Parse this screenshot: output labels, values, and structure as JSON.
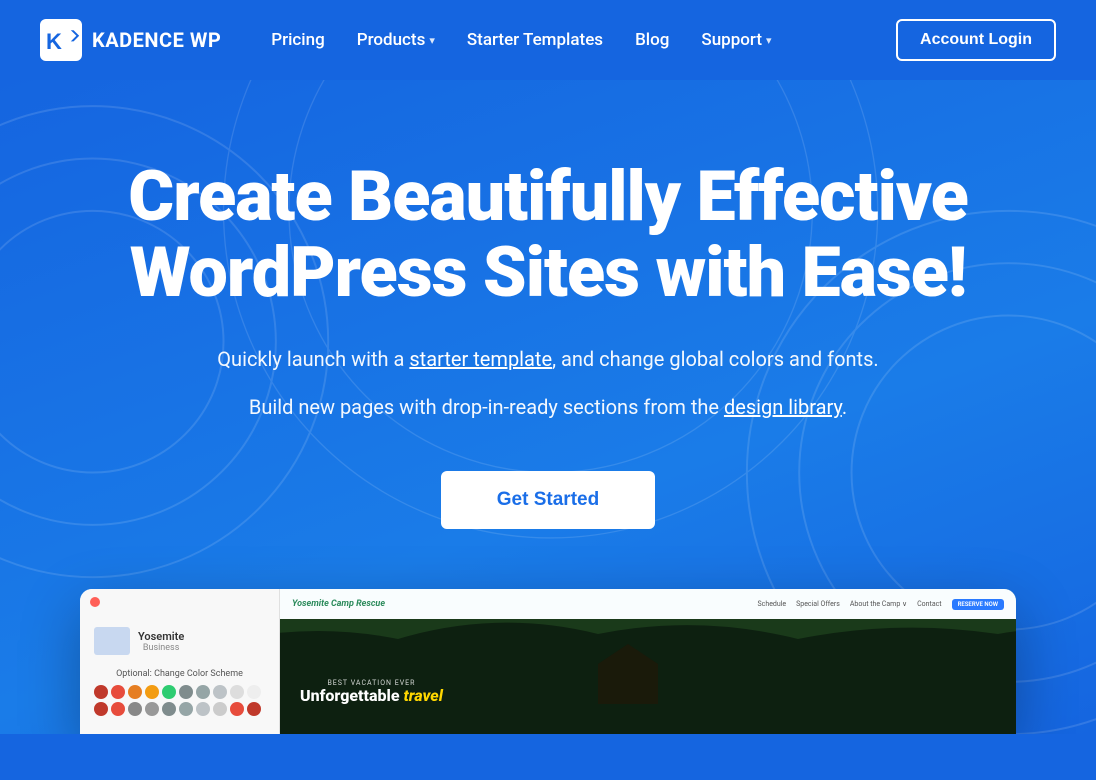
{
  "brand": {
    "name": "KADENCE WP",
    "logo_alt": "Kadence WP Logo"
  },
  "navbar": {
    "links": [
      {
        "label": "Pricing",
        "has_dropdown": false
      },
      {
        "label": "Products",
        "has_dropdown": true
      },
      {
        "label": "Starter Templates",
        "has_dropdown": false
      },
      {
        "label": "Blog",
        "has_dropdown": false
      },
      {
        "label": "Support",
        "has_dropdown": true
      }
    ],
    "account_login": "Account Login"
  },
  "hero": {
    "title": "Create Beautifully Effective WordPress Sites with Ease!",
    "subtitle_part1": "Quickly launch with a ",
    "subtitle_link1": "starter template",
    "subtitle_part2": ", and change global colors and fonts.",
    "subtitle2_part1": "Build new pages with drop-in-ready sections from the ",
    "subtitle2_link2": "design library",
    "subtitle2_part2": ".",
    "cta_button": "Get Started"
  },
  "preview": {
    "sidebar": {
      "site_name": "Yosemite",
      "site_type": "Business",
      "color_scheme_label": "Optional: Change Color Scheme",
      "swatches": [
        "#c0392b",
        "#e74c3c",
        "#e67e22",
        "#f39c12",
        "#27ae60",
        "#8e8e8e",
        "#7f8c8d",
        "#95a5a6",
        "#bdc3c7",
        "#ccc",
        "#ddd",
        "#eee",
        "#c0392b",
        "#e74c3c",
        "#888",
        "#999",
        "#7f8c8d",
        "#95a5a6",
        "#bdc3c7",
        "#ccc"
      ]
    },
    "main": {
      "nav_logo": "Yosemite Camp Rescue",
      "nav_links": [
        "Schedule",
        "Special Offers",
        "About the Camp ∨",
        "Contact"
      ],
      "nav_cta": "RESERVE NOW",
      "hero_label": "BEST VACATION EVER",
      "hero_title": "Unforgettable travel"
    }
  }
}
